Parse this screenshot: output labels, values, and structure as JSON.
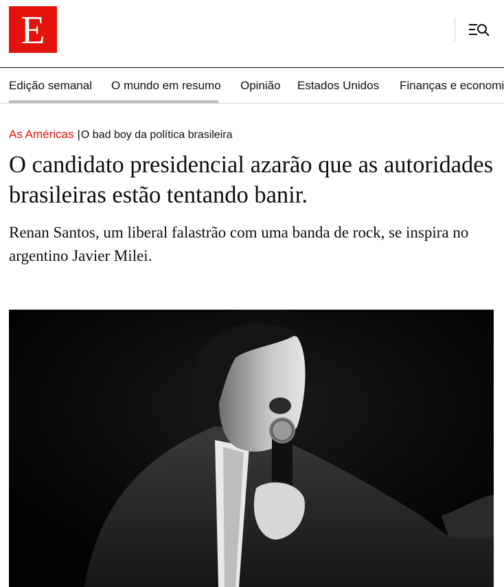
{
  "header": {
    "logo_letter": "E"
  },
  "nav": {
    "items": [
      {
        "label": "Edição semanal"
      },
      {
        "label": "O mundo em resumo"
      },
      {
        "label": "Opinião"
      },
      {
        "label": "Estados Unidos"
      },
      {
        "label": "Finanças e economia"
      }
    ]
  },
  "article": {
    "section": "As Américas",
    "separator": "|",
    "rubric": "O bad boy da política brasileira",
    "headline": "O candidato presidencial azarão que as autoridades brasileiras estão tentando banir.",
    "standfirst": "Renan Santos, um liberal falastrão com uma banda de rock, se inspira no argentino Javier Milei."
  },
  "icons": {
    "menu": "menu-search-icon"
  },
  "colors": {
    "brand_red": "#e3120b",
    "text": "#0d0d0d",
    "photo_background": "#050505"
  }
}
